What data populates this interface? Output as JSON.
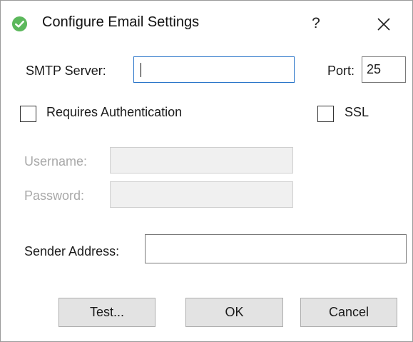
{
  "window": {
    "title": "Configure Email Settings",
    "help_label": "?",
    "app_icon": "green-checkmark-circle-icon",
    "close_icon": "close-icon"
  },
  "form": {
    "smtp_server_label": "SMTP Server:",
    "smtp_server_value": "",
    "port_label": "Port:",
    "port_value": "25",
    "requires_auth_label": "Requires Authentication",
    "requires_auth_checked": false,
    "ssl_label": "SSL",
    "ssl_checked": false,
    "username_label": "Username:",
    "username_value": "",
    "password_label": "Password:",
    "password_value": "",
    "sender_address_label": "Sender Address:",
    "sender_address_value": ""
  },
  "buttons": {
    "test_label": "Test...",
    "ok_label": "OK",
    "cancel_label": "Cancel"
  },
  "colors": {
    "accent_focus": "#2a75c9",
    "icon_green": "#5cb85c",
    "disabled_text": "#a8a8a8",
    "button_face": "#e3e3e3"
  }
}
